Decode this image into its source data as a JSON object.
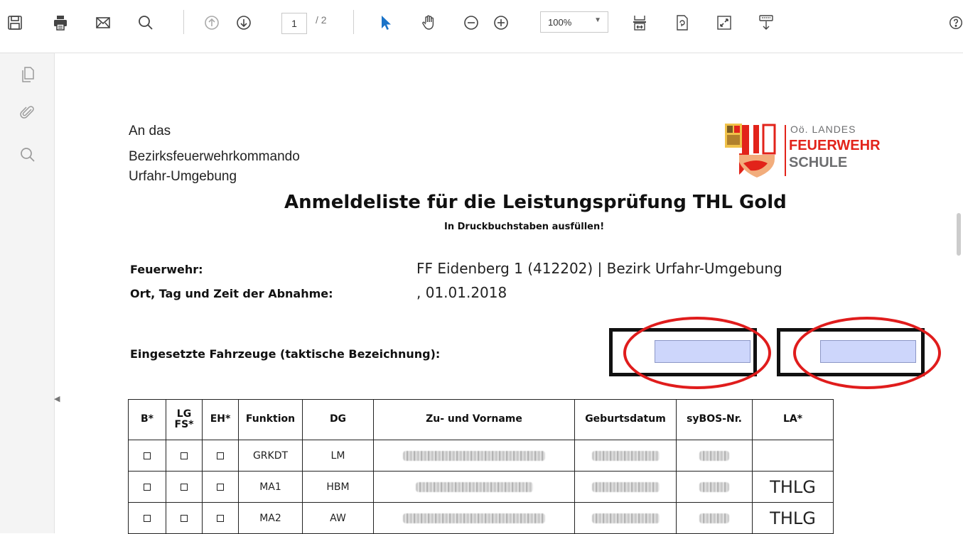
{
  "toolbar": {
    "page_current": "1",
    "page_total": "/ 2",
    "zoom": "100%"
  },
  "document": {
    "address": [
      "An das",
      "Bezirksfeuerwehrkommando",
      "Urfahr-Umgebung"
    ],
    "logo": {
      "line1": "Oö. LANDES",
      "line2": "FEUERWEHR",
      "line3": "SCHULE"
    },
    "title": "Anmeldeliste für die Leistungsprüfung THL Gold",
    "subtitle": "In Druckbuchstaben ausfüllen!",
    "feuerwehr_label": "Feuerwehr:",
    "feuerwehr_value": "FF Eidenberg 1 (412202) | Bezirk Urfahr-Umgebung",
    "ort_label": "Ort, Tag und Zeit der Abnahme:",
    "ort_value": ", 01.01.2018",
    "fahrzeuge_label": "Eingesetzte Fahrzeuge (taktische Bezeichnung):"
  },
  "table": {
    "headers": {
      "b": "B*",
      "lg_line1": "LG",
      "lg_line2": "FS*",
      "eh": "EH*",
      "funktion": "Funktion",
      "dg": "DG",
      "name": "Zu- und Vorname",
      "geburtsdatum": "Geburtsdatum",
      "sybos": "syBOS-Nr.",
      "la": "LA*"
    },
    "rows": [
      {
        "funktion": "GRKDT",
        "dg": "LM",
        "la": ""
      },
      {
        "funktion": "MA1",
        "dg": "HBM",
        "la": "THLG"
      },
      {
        "funktion": "MA2",
        "dg": "AW",
        "la": "THLG"
      }
    ]
  },
  "colors": {
    "field_fill": "#cdd6fb",
    "annotation_ring": "#e01c1c",
    "logo_red": "#e2231a",
    "logo_gray": "#6d6e70"
  }
}
